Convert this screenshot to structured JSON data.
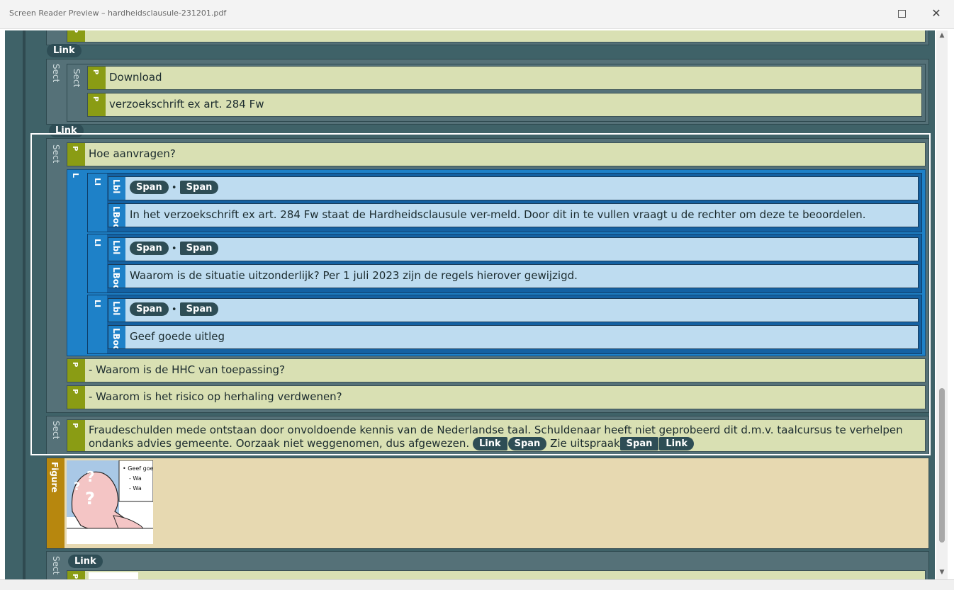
{
  "window": {
    "title": "Screen Reader Preview – hardheidsclausule-231201.pdf",
    "maximize_icon": "maximize-icon",
    "close_icon": "close-icon"
  },
  "tags": {
    "sect": "Sect",
    "p": "P",
    "l": "L",
    "li": "LI",
    "lbl": "Lbl",
    "lbody": "LBody",
    "link": "Link",
    "span": "Span",
    "figure": "Figure",
    "bullet": "•"
  },
  "block1": {
    "p1": "Download",
    "p2": "verzoekschrift ex art. 284 Fw"
  },
  "selected": {
    "heading": "Hoe aanvragen?",
    "items": [
      "In het verzoekschrift ex art. 284 Fw staat de Hardheidsclausule ver-meld. Door dit in te vullen vraagt u de rechter om deze te beoordelen.",
      "Waarom is de situatie uitzonderlijk? Per 1 juli 2023 zijn de regels hierover gewijzigd.",
      "Geef goede uitleg"
    ],
    "p_after1": "- Waarom is de HHC van toepassing?",
    "p_after2": "- Waarom is het risico op herhaling verdwenen?",
    "para_text": "Fraudeschulden mede ontstaan door onvoldoende kennis van de Nederlandse taal. Schuldenaar heeft niet geprobeerd dit d.m.v. taalcursus te verhelpen ondanks advies gemeente. Oorzaak niet weggenomen, dus afgewezen.",
    "para_mid": "Zie uitspraak"
  },
  "figure": {
    "thumb_lines": [
      "• Geef goe",
      "- Wa",
      "- Wa"
    ]
  },
  "colors": {
    "sect_bg": "#557178",
    "p_bg": "#d9e0b3",
    "p_tab": "#8a9c14",
    "list_blue": "#1e81c8",
    "item_bg": "#bedcf0",
    "figure_bg": "#e7d9b1",
    "figure_tab": "#b7870e",
    "pill": "#2e4d55"
  }
}
